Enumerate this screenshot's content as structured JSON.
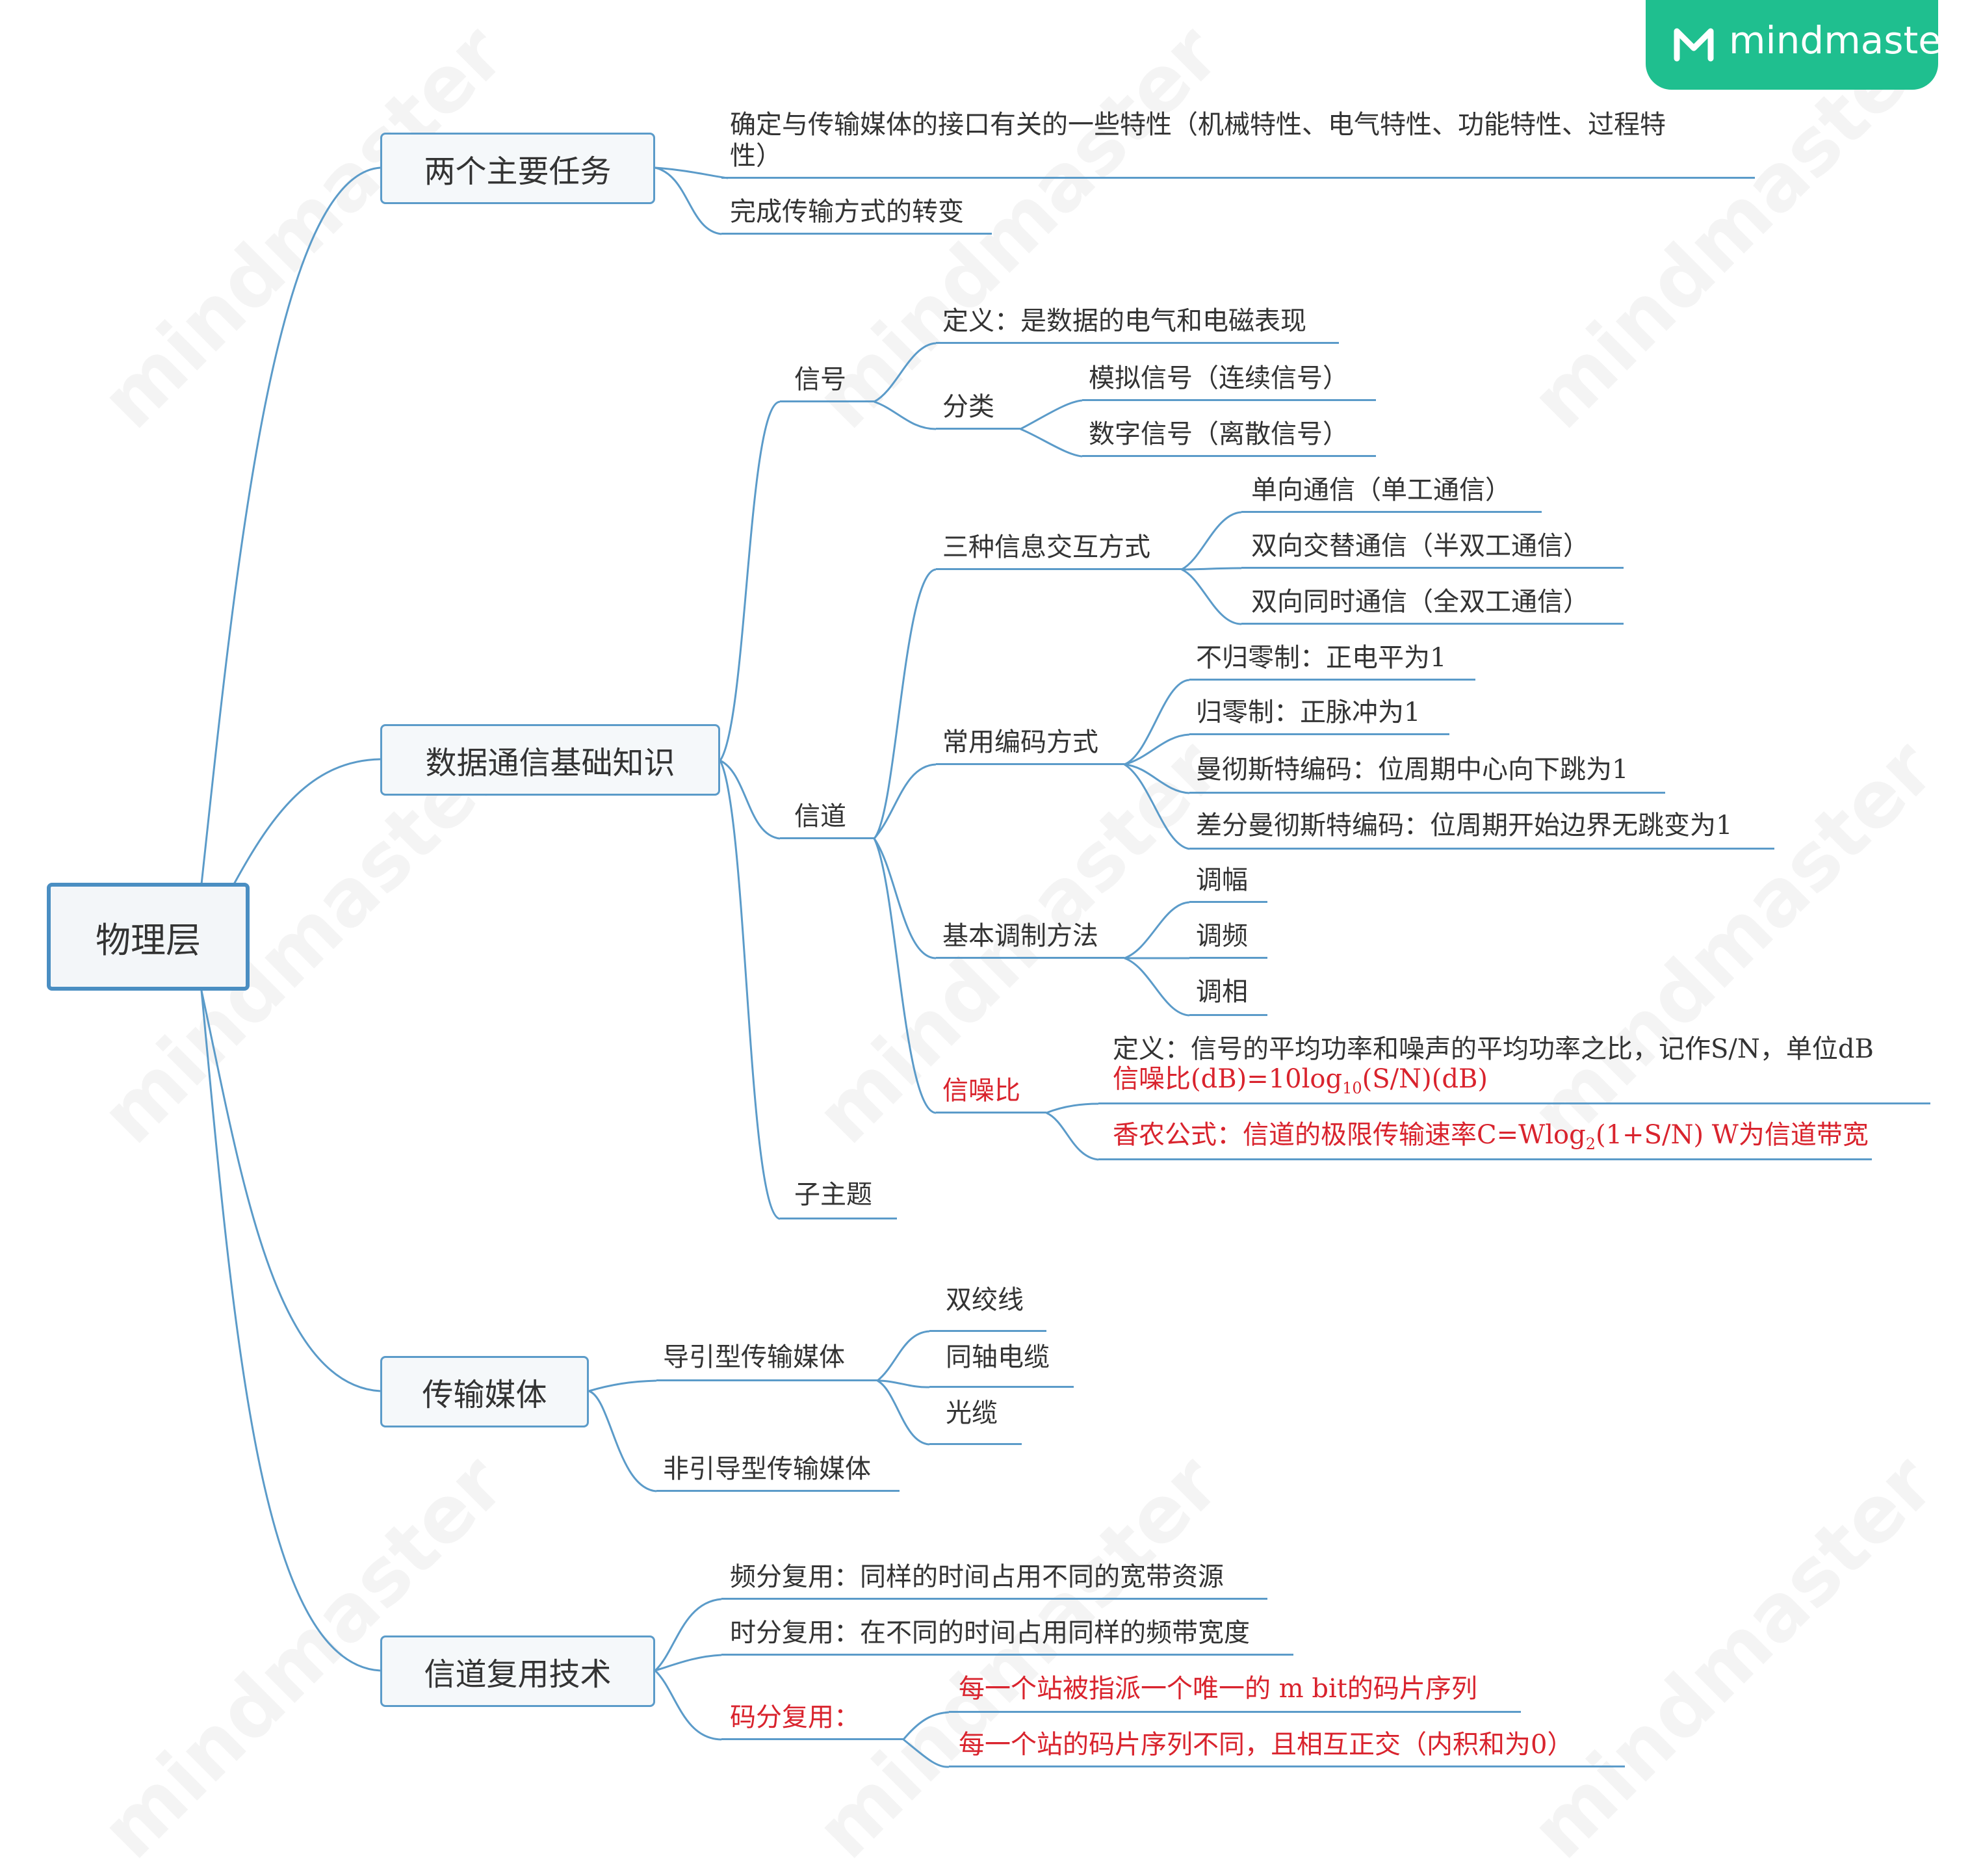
{
  "root": "物理层",
  "brand": "mindmaster",
  "watermark": "mindmaster",
  "accent_color": "#5b9bc9",
  "highlight_color": "#d9232d",
  "tasks": {
    "title": "两个主要任务",
    "item1": "确定与传输媒体的接口有关的一些特性（机械特性、电气特性、功能特性、过程特",
    "item1_cont": "性）",
    "item2": "完成传输方式的转变"
  },
  "comm": {
    "title": "数据通信基础知识",
    "signal": {
      "label": "信号",
      "definition": "定义：是数据的电气和电磁表现",
      "category_label": "分类",
      "analog": "模拟信号（连续信号）",
      "digital": "数字信号（离散信号）"
    },
    "channel": {
      "label": "信道",
      "interaction": {
        "label": "三种信息交互方式",
        "simplex": "单向通信（单工通信）",
        "half_duplex": "双向交替通信（半双工通信）",
        "full_duplex": "双向同时通信（全双工通信）"
      },
      "encoding": {
        "label": "常用编码方式",
        "nrz": "不归零制：正电平为1",
        "rz": "归零制：正脉冲为1",
        "manchester": "曼彻斯特编码：位周期中心向下跳为1",
        "diff_manchester": "差分曼彻斯特编码：位周期开始边界无跳变为1"
      },
      "modulation": {
        "label": "基本调制方法",
        "am": "调幅",
        "fm": "调频",
        "pm": "调相"
      },
      "snr": {
        "label": "信噪比",
        "definition": "定义：信号的平均功率和噪声的平均功率之比，记作S/N，单位dB",
        "formula_a": "信噪比(dB)=10log",
        "formula_sub": "10",
        "formula_b": "(S/N)(dB)",
        "shannon_a": "香农公式：信道的极限传输速率C=Wlog",
        "shannon_sub": "2",
        "shannon_b": "(1+S/N)  W为信道带宽"
      }
    },
    "subtopic": "子主题"
  },
  "media": {
    "title": "传输媒体",
    "guided": {
      "label": "导引型传输媒体",
      "twisted_pair": "双绞线",
      "coax": "同轴电缆",
      "fiber": "光缆"
    },
    "unguided": "非引导型传输媒体"
  },
  "mux": {
    "title": "信道复用技术",
    "fdm": "频分复用：同样的时间占用不同的宽带资源",
    "tdm": "时分复用：在不同的时间占用同样的频带宽度",
    "cdm": {
      "label": "码分复用：",
      "item1": "每一个站被指派一个唯一的 m bit的码片序列",
      "item2": "每一个站的码片序列不同，且相互正交（内积和为0）"
    }
  }
}
